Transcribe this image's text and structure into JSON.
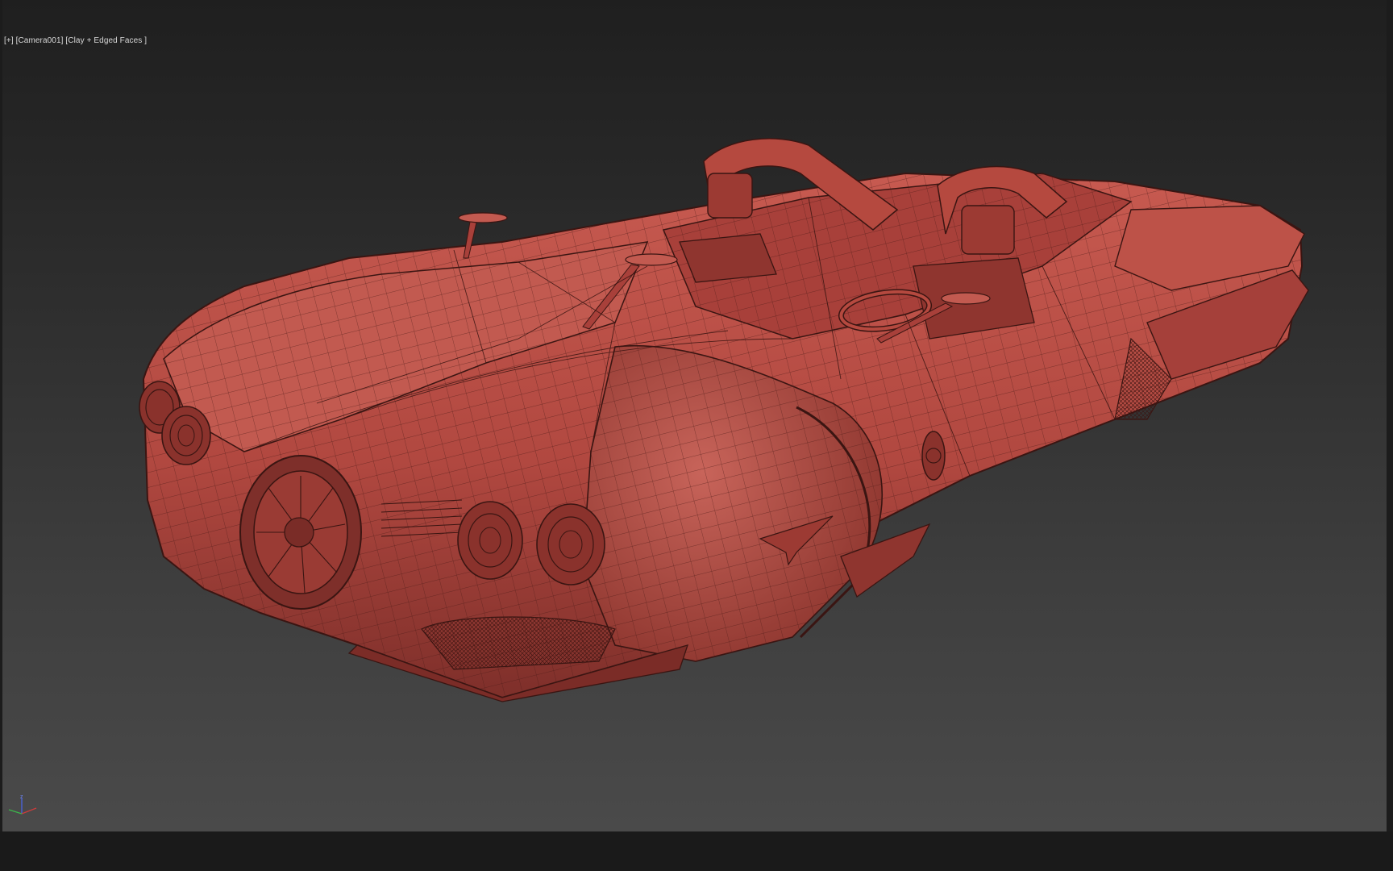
{
  "viewport": {
    "label_prefix": "[+]",
    "camera": "[Camera001]",
    "shading": "[Clay + Edged Faces ]"
  },
  "axis_gizmo": {
    "z_label": "z",
    "x_color": "#c83c3c",
    "y_color": "#3cb44b",
    "z_color": "#4a62d8"
  },
  "model": {
    "icon": "hover-car-model",
    "clay_color": "#b8483f",
    "edge_color": "#3a1512"
  }
}
